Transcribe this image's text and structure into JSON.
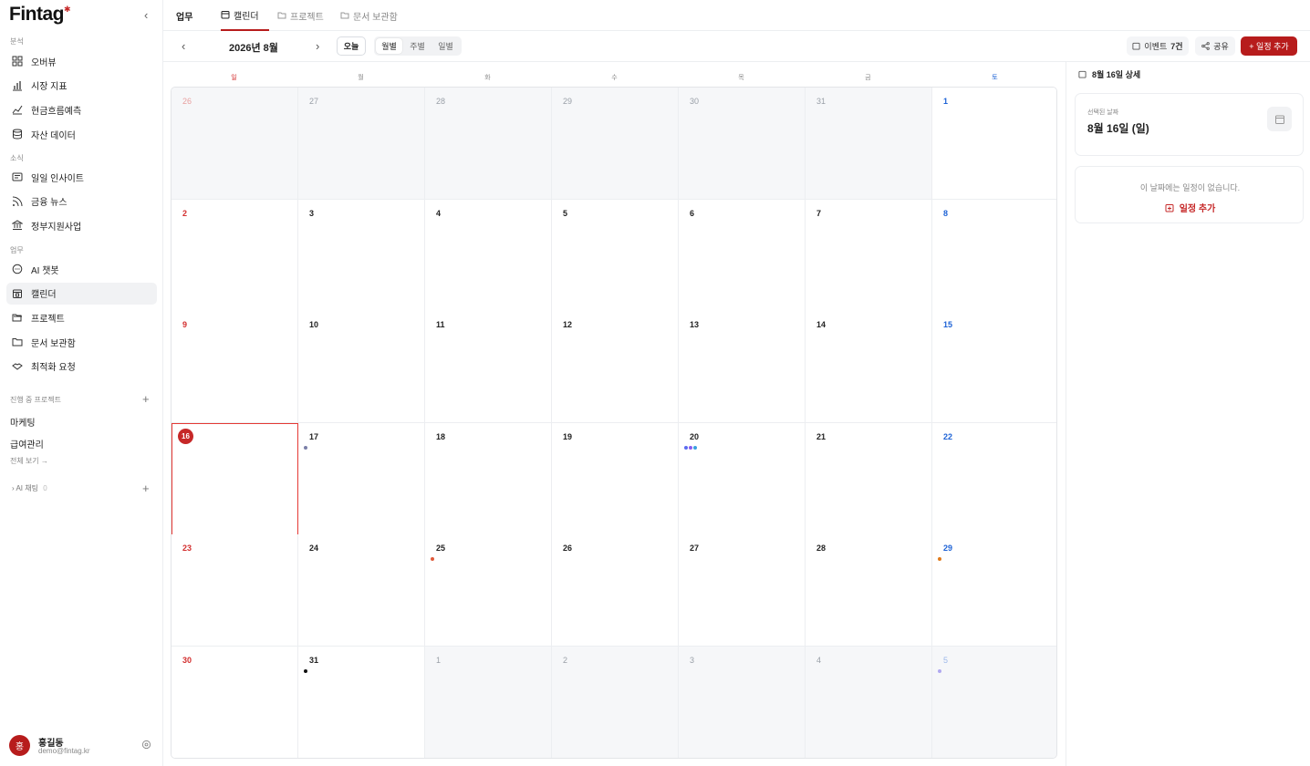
{
  "brand": {
    "name": "Fintag",
    "mark": "✱"
  },
  "sidebar": {
    "sections": {
      "analysis": "분석",
      "news": "소식",
      "work": "업무"
    },
    "analysis_items": [
      {
        "label": "오버뷰",
        "icon": "grid-icon"
      },
      {
        "label": "시장 지표",
        "icon": "bar-chart-icon"
      },
      {
        "label": "현금흐름예측",
        "icon": "trend-line-icon"
      },
      {
        "label": "자산 데이터",
        "icon": "database-icon"
      }
    ],
    "news_items": [
      {
        "label": "일일 인사이트",
        "icon": "newspaper-icon"
      },
      {
        "label": "금융 뉴스",
        "icon": "rss-icon"
      },
      {
        "label": "정부지원사업",
        "icon": "bank-icon"
      }
    ],
    "work_items": [
      {
        "label": "AI 챗봇",
        "icon": "chat-icon"
      },
      {
        "label": "캘린더",
        "icon": "calendar-icon",
        "active": true
      },
      {
        "label": "프로젝트",
        "icon": "folder-open-icon"
      },
      {
        "label": "문서 보관함",
        "icon": "folder-icon"
      },
      {
        "label": "최적화 요청",
        "icon": "handshake-icon"
      }
    ],
    "projects_header": "진행 중 프로젝트",
    "projects": [
      "마케팅",
      "급여관리"
    ],
    "view_all": "전체 보기 →",
    "ai_chat": "AI 채팅",
    "ai_chat_count": "0"
  },
  "user": {
    "initial": "홍",
    "name": "홍길동",
    "email": "demo@fintag.kr"
  },
  "topbar": {
    "section": "업무",
    "tabs": [
      "캘린더",
      "프로젝트",
      "문서 보관함"
    ]
  },
  "toolbar": {
    "month": "2026년 8월",
    "today": "오늘",
    "views": [
      "월별",
      "주별",
      "일별"
    ],
    "events_label": "이벤트",
    "events_count": "7건",
    "share": "공유",
    "add_event": "+ 일정 추가"
  },
  "calendar": {
    "weekdays": [
      "일",
      "월",
      "화",
      "수",
      "목",
      "금",
      "토"
    ],
    "weeks": [
      [
        {
          "d": "26",
          "out": true
        },
        {
          "d": "27",
          "out": true
        },
        {
          "d": "28",
          "out": true
        },
        {
          "d": "29",
          "out": true
        },
        {
          "d": "30",
          "out": true
        },
        {
          "d": "31",
          "out": true
        },
        {
          "d": "1"
        }
      ],
      [
        {
          "d": "2"
        },
        {
          "d": "3"
        },
        {
          "d": "4"
        },
        {
          "d": "5"
        },
        {
          "d": "6"
        },
        {
          "d": "7"
        },
        {
          "d": "8"
        }
      ],
      [
        {
          "d": "9"
        },
        {
          "d": "10"
        },
        {
          "d": "11"
        },
        {
          "d": "12"
        },
        {
          "d": "13"
        },
        {
          "d": "14"
        },
        {
          "d": "15"
        }
      ],
      [
        {
          "d": "16",
          "selected": true
        },
        {
          "d": "17",
          "dots": [
            "#7a7fa8"
          ]
        },
        {
          "d": "18"
        },
        {
          "d": "19"
        },
        {
          "d": "20",
          "dots": [
            "#5b6cf0",
            "#8a5cf0",
            "#3aa0e0"
          ]
        },
        {
          "d": "21"
        },
        {
          "d": "22"
        }
      ],
      [
        {
          "d": "23"
        },
        {
          "d": "24"
        },
        {
          "d": "25",
          "dots": [
            "#e05a3a"
          ]
        },
        {
          "d": "26"
        },
        {
          "d": "27"
        },
        {
          "d": "28"
        },
        {
          "d": "29",
          "dots": [
            "#e07a1a"
          ]
        }
      ],
      [
        {
          "d": "30"
        },
        {
          "d": "31",
          "dots": [
            "#111111"
          ]
        },
        {
          "d": "1",
          "out": true
        },
        {
          "d": "2",
          "out": true
        },
        {
          "d": "3",
          "out": true
        },
        {
          "d": "4",
          "out": true
        },
        {
          "d": "5",
          "out": true,
          "dots": [
            "#b0a8f0"
          ]
        }
      ]
    ]
  },
  "detail": {
    "title": "8월 16일 상세",
    "selected_label": "선택된 날짜",
    "selected_date": "8월 16일 (일)",
    "empty_text": "이 날짜에는 일정이 없습니다.",
    "add_label": "일정 추가"
  },
  "colors": {
    "accent": "#b71c1c",
    "sunday": "#d32f2f",
    "saturday": "#1e63d6"
  }
}
